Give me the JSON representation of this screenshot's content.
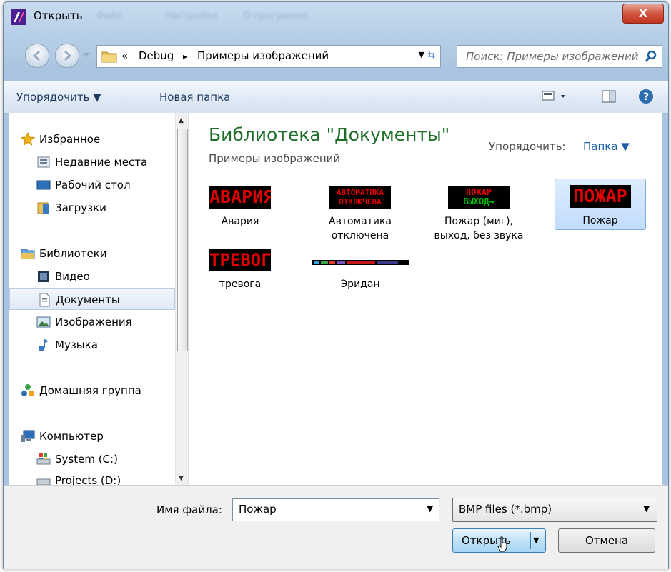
{
  "window": {
    "title": "Открыть",
    "close_label": "X",
    "blurred_menu": [
      "Файл",
      "Настройки",
      "О программе"
    ]
  },
  "address": {
    "prefix": "«",
    "crumbs": [
      "Debug",
      "Примеры изображений"
    ],
    "sep": "▸"
  },
  "search": {
    "placeholder": "Поиск: Примеры изображений"
  },
  "toolbar": {
    "arrange_label": "Упорядочить ▼",
    "new_folder_label": "Новая папка"
  },
  "sidebar": {
    "items": [
      {
        "label": "Избранное",
        "icon": "star-icon"
      },
      {
        "label": "Недавние места",
        "icon": "recent-places-icon"
      },
      {
        "label": "Рабочий стол",
        "icon": "desktop-icon"
      },
      {
        "label": "Загрузки",
        "icon": "downloads-icon"
      },
      {
        "label": "Библиотеки",
        "icon": "libraries-icon"
      },
      {
        "label": "Видео",
        "icon": "video-icon"
      },
      {
        "label": "Документы",
        "icon": "documents-icon"
      },
      {
        "label": "Изображения",
        "icon": "pictures-icon"
      },
      {
        "label": "Музыка",
        "icon": "music-icon"
      },
      {
        "label": "Домашняя группа",
        "icon": "homegroup-icon"
      },
      {
        "label": "Компьютер",
        "icon": "computer-icon"
      },
      {
        "label": "System (C:)",
        "icon": "system-drive-icon"
      },
      {
        "label": "Projects (D:)",
        "icon": "drive-icon"
      }
    ]
  },
  "main": {
    "library_title": "Библиотека \"Документы\"",
    "library_subtitle": "Примеры изображений",
    "arrange_label": "Упорядочить:",
    "arrange_value": "Папка ▼",
    "files": [
      {
        "label1": "Авария",
        "label2": "",
        "thumb_text": "АВАРИЯ"
      },
      {
        "label1": "Автоматика",
        "label2": "отключена",
        "thumb_text1": "АВТОМАТИКА",
        "thumb_text2": "ОТКЛЮЧЕНА"
      },
      {
        "label1": "Пожар (миг),",
        "label2": "выход, без звука",
        "thumb_text1": "ПОЖАР",
        "thumb_text2": "ВЫХОД→"
      },
      {
        "label1": "Пожар",
        "label2": "",
        "thumb_text": "ПОЖАР"
      },
      {
        "label1": "тревога",
        "label2": "",
        "thumb_text": "ТРЕВОГА"
      },
      {
        "label1": "Эридан",
        "label2": ""
      }
    ]
  },
  "bottom": {
    "filename_label": "Имя файла:",
    "filename_value": "Пожар",
    "filetype_value": "BMP files (*.bmp)",
    "open_label": "Открыть",
    "cancel_label": "Отмена"
  },
  "colors": {
    "accent": "#1e6e2a",
    "selection": "#c2dcfd",
    "led_red": "#e00000",
    "led_green": "#00c000"
  }
}
